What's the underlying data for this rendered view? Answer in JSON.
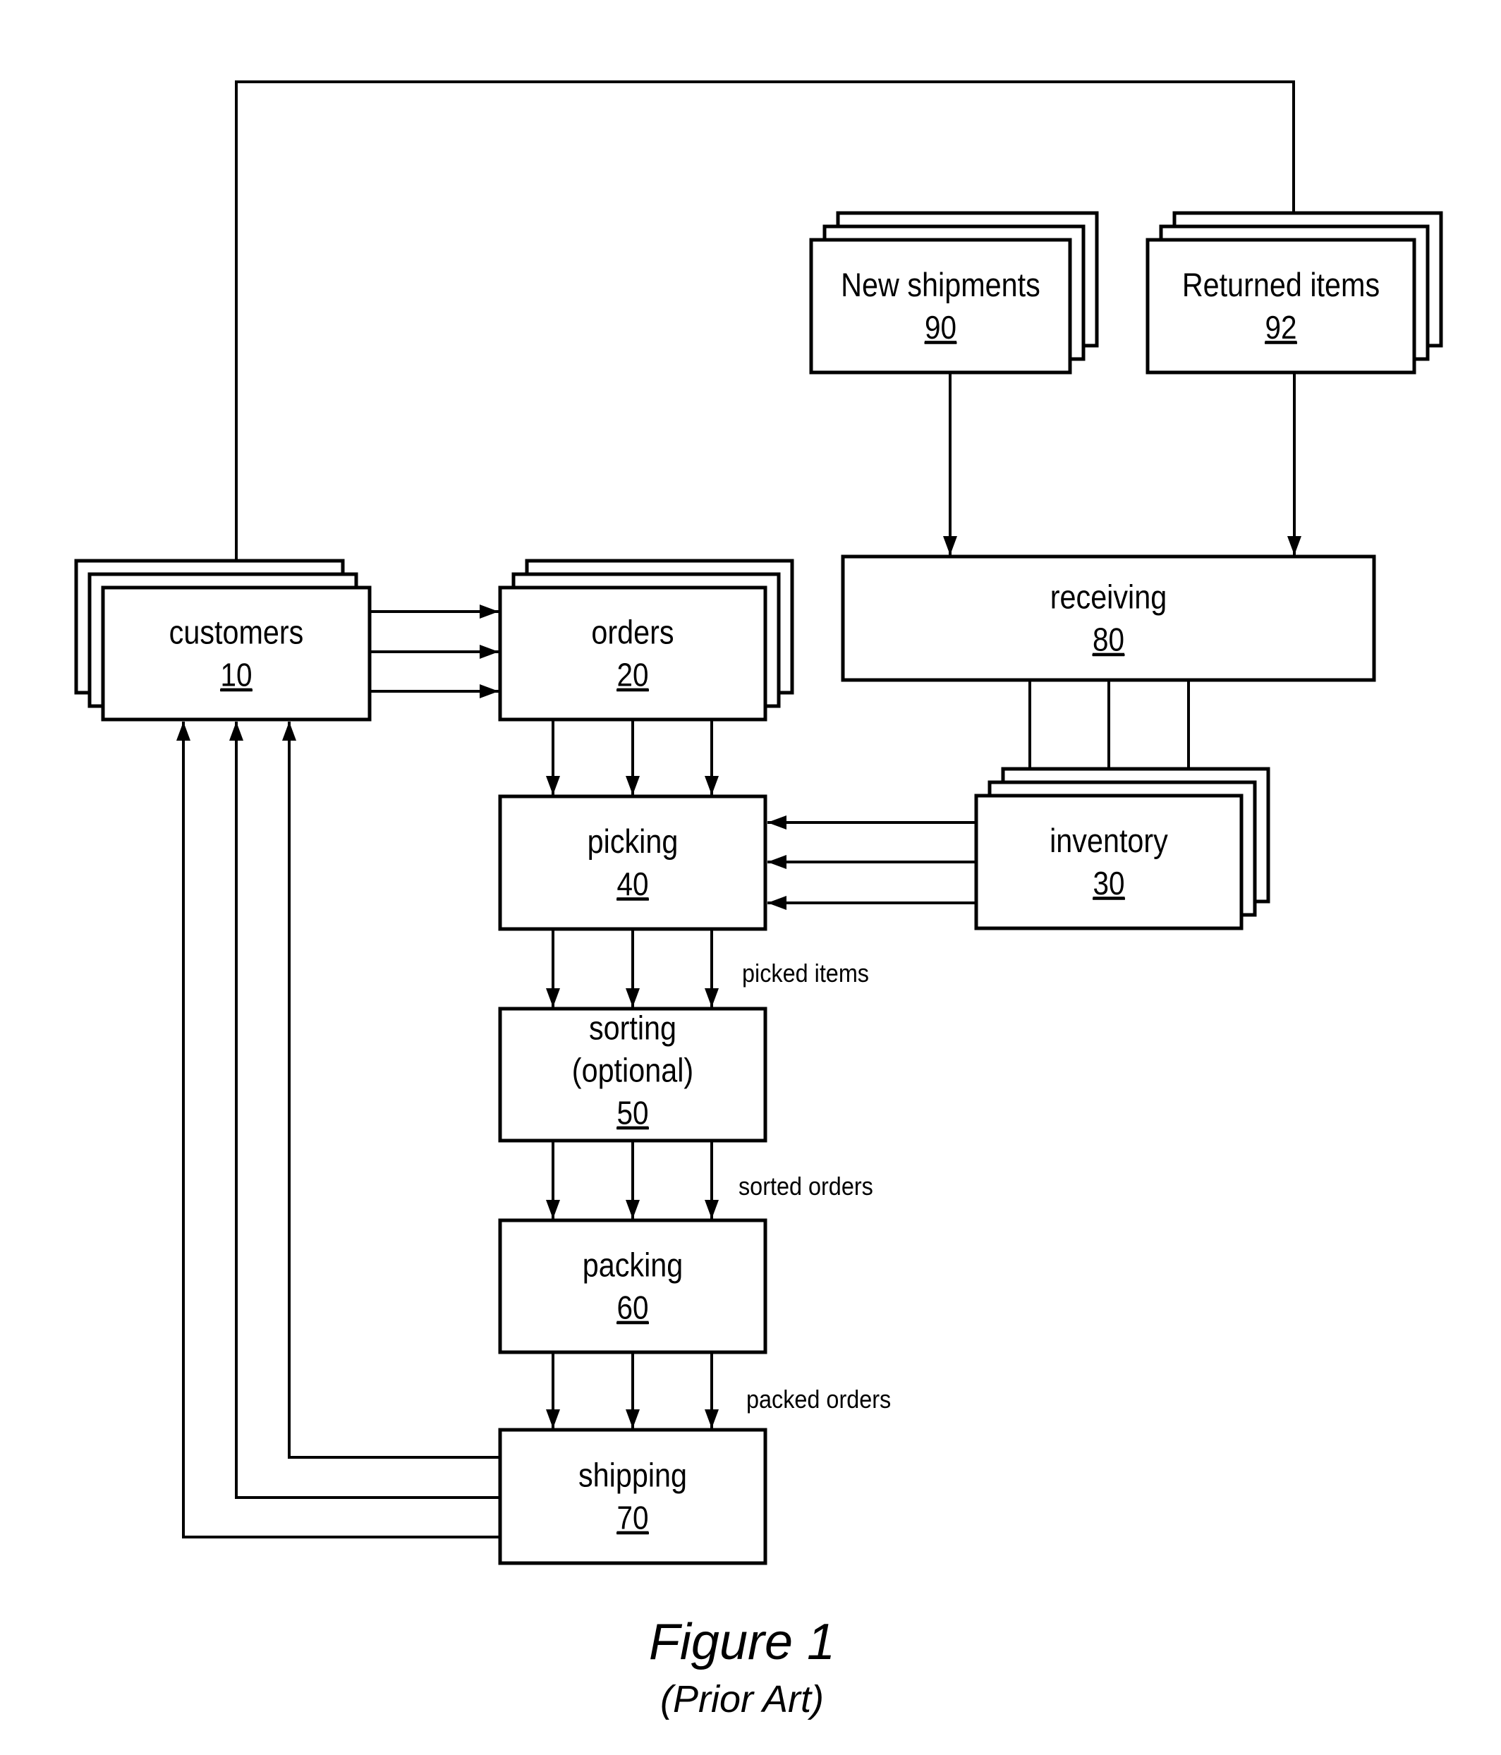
{
  "figure": {
    "title": "Figure 1",
    "subtitle": "(Prior Art)"
  },
  "nodes": [
    {
      "id": "customers",
      "label": "customers",
      "ref": "10",
      "stacked": true
    },
    {
      "id": "orders",
      "label": "orders",
      "ref": "20",
      "stacked": true
    },
    {
      "id": "inventory",
      "label": "inventory",
      "ref": "30",
      "stacked": true
    },
    {
      "id": "picking",
      "label": "picking",
      "ref": "40",
      "stacked": false
    },
    {
      "id": "sorting",
      "label": "sorting",
      "sublabel": "(optional)",
      "ref": "50",
      "stacked": false
    },
    {
      "id": "packing",
      "label": "packing",
      "ref": "60",
      "stacked": false
    },
    {
      "id": "shipping",
      "label": "shipping",
      "ref": "70",
      "stacked": false
    },
    {
      "id": "receiving",
      "label": "receiving",
      "ref": "80",
      "stacked": false
    },
    {
      "id": "new-shipments",
      "label": "New shipments",
      "ref": "90",
      "stacked": true
    },
    {
      "id": "returned-items",
      "label": "Returned items",
      "ref": "92",
      "stacked": true
    }
  ],
  "edges": [
    {
      "from": "customers",
      "to": "orders",
      "count": 3,
      "label": ""
    },
    {
      "from": "orders",
      "to": "picking",
      "count": 3,
      "label": ""
    },
    {
      "from": "inventory",
      "to": "picking",
      "count": 3,
      "label": ""
    },
    {
      "from": "picking",
      "to": "sorting",
      "count": 3,
      "label": "picked items"
    },
    {
      "from": "sorting",
      "to": "packing",
      "count": 3,
      "label": "sorted orders"
    },
    {
      "from": "packing",
      "to": "shipping",
      "count": 3,
      "label": "packed orders"
    },
    {
      "from": "shipping",
      "to": "customers",
      "count": 3,
      "label": ""
    },
    {
      "from": "customers",
      "to": "returned-items",
      "count": 1,
      "label": ""
    },
    {
      "from": "new-shipments",
      "to": "receiving",
      "count": 1,
      "label": ""
    },
    {
      "from": "returned-items",
      "to": "receiving",
      "count": 1,
      "label": ""
    },
    {
      "from": "receiving",
      "to": "inventory",
      "count": 3,
      "label": ""
    }
  ]
}
